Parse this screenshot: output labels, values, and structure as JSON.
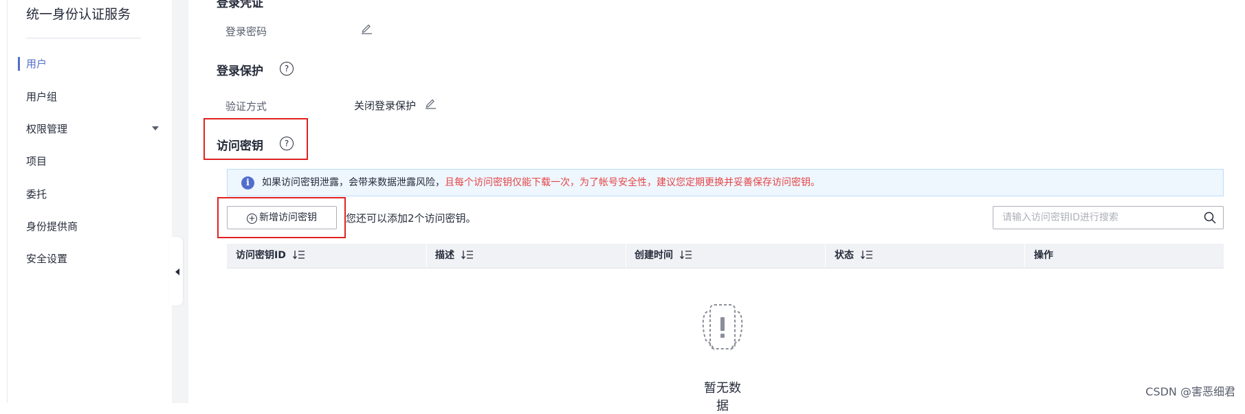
{
  "sidebar": {
    "title": "统一身份认证服务",
    "items": [
      {
        "label": "用户",
        "active": true
      },
      {
        "label": "用户组",
        "active": false
      },
      {
        "label": "权限管理",
        "active": false,
        "expandable": true
      },
      {
        "label": "项目",
        "active": false
      },
      {
        "label": "委托",
        "active": false
      },
      {
        "label": "身份提供商",
        "active": false
      },
      {
        "label": "安全设置",
        "active": false
      }
    ]
  },
  "login_credentials": {
    "title_partial": "登录凭证",
    "password_label": "登录密码"
  },
  "login_protection": {
    "title": "登录保护",
    "method_label": "验证方式",
    "method_value": "关闭登录保护"
  },
  "access_keys": {
    "title": "访问密钥",
    "alert_normal": "如果访问密钥泄露，会带来数据泄露风险，",
    "alert_highlight": "且每个访问密钥仅能下载一次，为了帐号安全性，建议您定期更换并妥善保存访问密钥。",
    "add_button": "新增访问密钥",
    "add_hint": "您还可以添加2个访问密钥。",
    "search_placeholder": "请输入访问密钥ID进行搜索",
    "columns": [
      "访问密钥ID",
      "描述",
      "创建时间",
      "状态",
      "操作"
    ],
    "empty_text": "暂无数据"
  },
  "watermark": "CSDN @害恶细君",
  "colors": {
    "accent": "#526ecc",
    "highlight_box": "#e02020",
    "alert_text_red": "#e54545",
    "alert_bg": "#eef6fe"
  }
}
